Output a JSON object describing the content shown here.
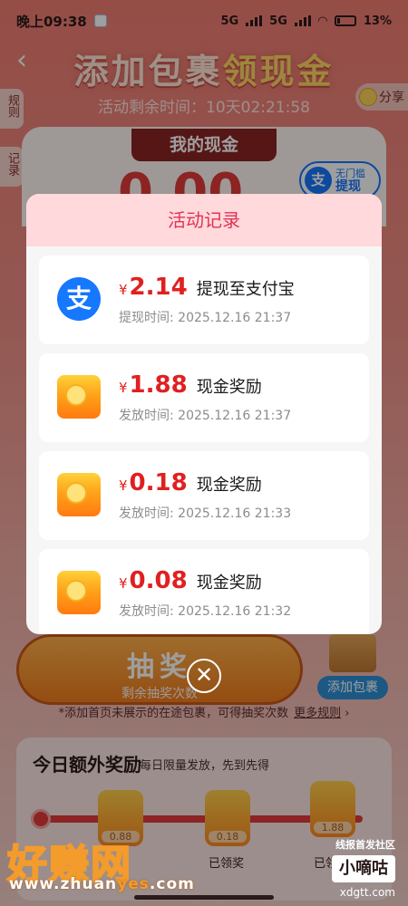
{
  "status_bar": {
    "time": "晚上09:38",
    "network1": "5G",
    "network2": "5G",
    "battery": "13%"
  },
  "page": {
    "title_part1": "添加包裹",
    "title_part2": "领现金",
    "countdown": "活动剩余时间：10天02:21:58",
    "rules_tab": "规则",
    "records_tab": "记录",
    "share": "分享",
    "my_cash_label": "我的现金",
    "cash_amount": "0.00",
    "withdraw_top": "无门槛",
    "withdraw_label": "提现",
    "alipay_char": "支"
  },
  "draw": {
    "label": "抽奖",
    "remaining": "剩余抽奖次数",
    "add_package": "添加包裹"
  },
  "tip": {
    "text": "*添加首页未展示的在途包裹，可得抽奖次数",
    "more": "更多规则"
  },
  "extra": {
    "title": "今日额外奖励",
    "subtitle": "每日限量发放，先到先得",
    "rewards": [
      {
        "value": "0.88",
        "state": ""
      },
      {
        "value": "0.18",
        "state": "已领奖"
      },
      {
        "value": "1.88",
        "state": "已领奖"
      }
    ]
  },
  "modal": {
    "title": "活动记录",
    "records": [
      {
        "icon": "alipay-icon",
        "amount": "2.14",
        "type": "提现至支付宝",
        "time": "提现时间: 2025.12.16 21:37"
      },
      {
        "icon": "red-envelope-icon",
        "amount": "1.88",
        "type": "现金奖励",
        "time": "发放时间: 2025.12.16 21:37"
      },
      {
        "icon": "red-envelope-icon",
        "amount": "0.18",
        "type": "现金奖励",
        "time": "发放时间: 2025.12.16 21:33"
      },
      {
        "icon": "red-envelope-icon",
        "amount": "0.08",
        "type": "现金奖励",
        "time": "发放时间: 2025.12.16 21:32"
      }
    ],
    "currency": "¥",
    "close": "✕"
  },
  "watermark": {
    "left_brand": "好赚网",
    "left_url_a": "www.zhuan",
    "left_url_b": "yes",
    "left_url_c": ".com",
    "right_line1": "线报首发社区",
    "right_brand": "小嘀咕",
    "right_url": "xdgtt.com"
  }
}
